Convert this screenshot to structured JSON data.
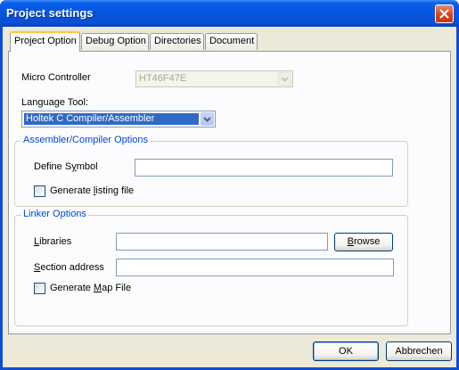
{
  "window": {
    "title": "Project settings",
    "close_icon": "close-x"
  },
  "tabs": [
    {
      "label": "Project Option",
      "active": true
    },
    {
      "label": "Debug Option",
      "active": false
    },
    {
      "label": "Directories",
      "active": false
    },
    {
      "label": "Document",
      "active": false
    }
  ],
  "project_option": {
    "micro_controller": {
      "label": "Micro Controller",
      "value": "HT46F47E",
      "enabled": false
    },
    "language_tool": {
      "label": "Language Tool:",
      "value": "Holtek C Compiler/Assembler"
    },
    "assembler_group": {
      "title": "Assembler/Compiler Options",
      "define_symbol": {
        "label_pre": "Define S",
        "label_u": "y",
        "label_post": "mbol",
        "value": ""
      },
      "listing": {
        "label_pre": "Generate ",
        "label_u": "l",
        "label_post": "isting file",
        "checked": false
      }
    },
    "linker_group": {
      "title": "Linker Options",
      "libraries": {
        "label_pre": "",
        "label_u": "L",
        "label_post": "ibraries",
        "value": ""
      },
      "browse": {
        "label_pre": "",
        "label_u": "B",
        "label_post": "rowse"
      },
      "section_address": {
        "label_pre": "",
        "label_u": "S",
        "label_post": "ection address",
        "value": ""
      },
      "map_file": {
        "label_pre": "Generate ",
        "label_u": "M",
        "label_post": "ap File",
        "checked": false
      }
    }
  },
  "footer": {
    "ok_label": "OK",
    "cancel_label": "Abbrechen"
  }
}
